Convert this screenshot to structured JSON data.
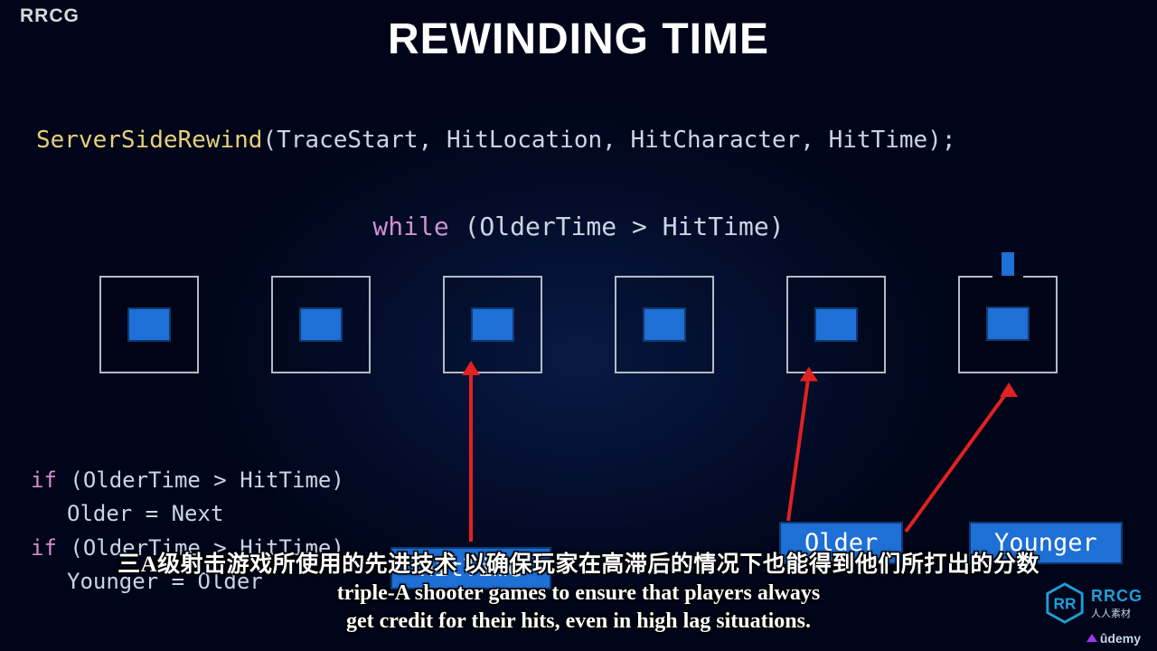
{
  "watermark_tl": "RRCG",
  "title": "REWINDING TIME",
  "code1": {
    "func": "ServerSideRewind",
    "args": "TraceStart, HitLocation, HitCharacter, HitTime"
  },
  "code2": {
    "kw": "while",
    "cond": "OlderTime > HitTime"
  },
  "code_block": {
    "l1_kw": "if",
    "l1_cond": "OlderTime > HitTime",
    "l2": "Older = Next",
    "l3_kw": "if",
    "l3_cond": "OlderTime > HitTime",
    "l4": "Younger = Older"
  },
  "labels": {
    "older": "Older",
    "younger": "Younger",
    "hittime": "HitTime"
  },
  "subs": {
    "cn": "三A级射击游戏所使用的先进技术 以确保玩家在高滞后的情况下也能得到他们所打出的分数",
    "en1": "triple-A shooter games to ensure that players always",
    "en2": "get credit for their hits, even in high lag situations."
  },
  "logo": {
    "name": "RRCG",
    "sub": "人人素材",
    "platform": "ûdemy"
  },
  "frame_count": 6
}
